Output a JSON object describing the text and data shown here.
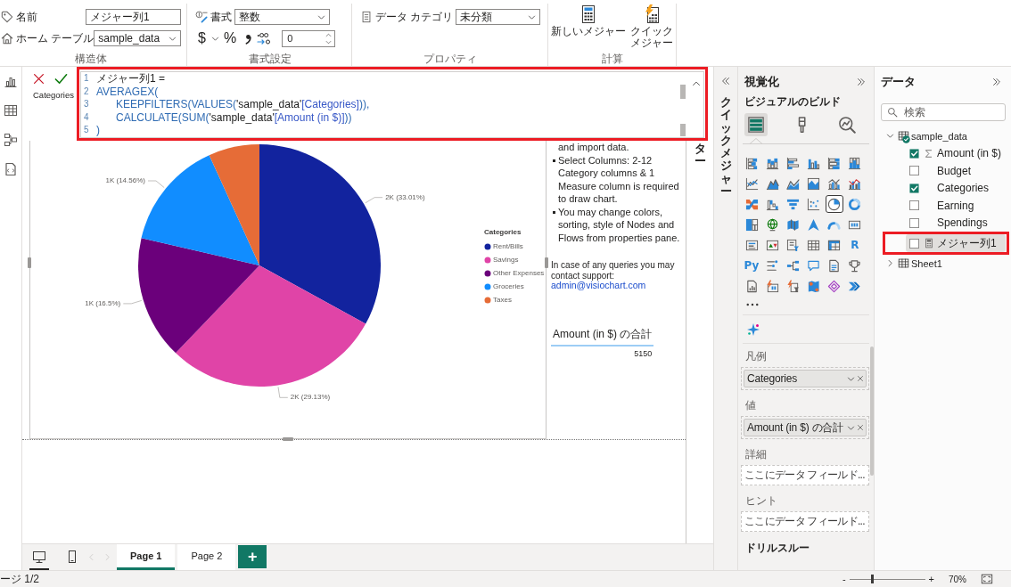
{
  "ribbon": {
    "structure": {
      "name_label": "名前",
      "name_value": "メジャー列1",
      "table_label": "ホーム テーブル",
      "table_value": "sample_data",
      "group_label": "構造体"
    },
    "formatting": {
      "format_label": "書式",
      "format_value": "整数",
      "currency_symbol": "$",
      "percent_symbol": "%",
      "decimal_places": "0",
      "group_label": "書式設定"
    },
    "properties": {
      "category_label": "データ カテゴリ",
      "category_value": "未分類",
      "group_label": "プロパティ"
    },
    "calculations": {
      "buttons": [
        {
          "kind": "new",
          "label": "新しいメジャー"
        },
        {
          "kind": "quick",
          "label": "クイックメジャー"
        }
      ],
      "group_label": "計算"
    }
  },
  "view_rail": {
    "views": [
      {
        "kind": "report"
      },
      {
        "kind": "table"
      },
      {
        "kind": "model"
      },
      {
        "kind": "query"
      }
    ]
  },
  "formula_bar": {
    "highlighted": true,
    "lines": [
      {
        "number": "1",
        "indent": false,
        "tokens": [
          {
            "kind": "plain",
            "text": "メジャー列1 ="
          }
        ]
      },
      {
        "number": "2",
        "indent": false,
        "tokens": [
          {
            "kind": "function",
            "text": "AVERAGEX("
          }
        ]
      },
      {
        "number": "3",
        "indent": true,
        "tokens": [
          {
            "kind": "function",
            "text": "KEEPFILTERS(VALUES("
          },
          {
            "kind": "table",
            "text": "'sample_data'"
          },
          {
            "kind": "column",
            "text": "[Categories]"
          },
          {
            "kind": "function",
            "text": ")),"
          }
        ]
      },
      {
        "number": "4",
        "indent": true,
        "tokens": [
          {
            "kind": "function",
            "text": "CALCULATE(SUM("
          },
          {
            "kind": "table",
            "text": "'sample_data'"
          },
          {
            "kind": "column",
            "text": "[Amount (in $)]"
          },
          {
            "kind": "function",
            "text": "))"
          }
        ]
      },
      {
        "number": "5",
        "indent": false,
        "tokens": [
          {
            "kind": "function",
            "text": ")"
          }
        ]
      }
    ]
  },
  "canvas": {
    "pie_visual": {
      "chart_data": {
        "type": "pie",
        "title": "Categories",
        "categories": [
          "Rent/Bills",
          "Savings",
          "Other Expenses",
          "Groceries",
          "Taxes"
        ],
        "values": [
          1700,
          1500,
          850,
          750,
          350
        ],
        "colors": [
          "#12239e",
          "#e044a7",
          "#6b007b",
          "#118dff",
          "#e66c37"
        ],
        "value_labels": [
          "2K (33.01%)",
          "2K (29.13%)",
          "1K (16.5%)",
          "1K (14.56%)",
          null
        ],
        "legend": {
          "title": "Categories"
        }
      }
    },
    "text_visual": {
      "paragraphs": [
        {
          "bullet": false,
          "text": "and import data."
        },
        {
          "bullet": true,
          "text": "Select Columns: 2-12 Category columns & 1 Measure column is required to draw chart."
        },
        {
          "bullet": true,
          "text": "You may change colors, sorting, style of Nodes and Flows from properties pane."
        }
      ],
      "contact": "In case of any queries you may contact support:",
      "email": "admin@visiochart.com"
    },
    "table_visual": {
      "column": "Amount (in $) の合計",
      "value": "5150"
    }
  },
  "filters_pane": {
    "label": "ター"
  },
  "quick_measure_pane": {
    "label": "クイックメジャー"
  },
  "visualizations_pane": {
    "title": "視覚化",
    "subtitle": "ビジュアルのビルド",
    "build_tabs": [
      {
        "kind": "build",
        "selected": true
      },
      {
        "kind": "format",
        "selected": false
      },
      {
        "kind": "analytics",
        "selected": false
      }
    ],
    "visual_types": [
      {
        "kind": "stacked-bar",
        "selected": false
      },
      {
        "kind": "stacked-column",
        "selected": false
      },
      {
        "kind": "clustered-bar",
        "selected": false
      },
      {
        "kind": "clustered-column",
        "selected": false
      },
      {
        "kind": "full-bar",
        "selected": false
      },
      {
        "kind": "full-column",
        "selected": false
      },
      {
        "kind": "line",
        "selected": false
      },
      {
        "kind": "area",
        "selected": false
      },
      {
        "kind": "stacked-area",
        "selected": false
      },
      {
        "kind": "full-area",
        "selected": false
      },
      {
        "kind": "line-stacked-column",
        "selected": false
      },
      {
        "kind": "line-clustered-column",
        "selected": false
      },
      {
        "kind": "ribbon",
        "selected": false
      },
      {
        "kind": "waterfall",
        "selected": false
      },
      {
        "kind": "funnel",
        "selected": false
      },
      {
        "kind": "scatter",
        "selected": false
      },
      {
        "kind": "pie",
        "selected": true
      },
      {
        "kind": "donut",
        "selected": false
      },
      {
        "kind": "treemap",
        "selected": false
      },
      {
        "kind": "globe",
        "selected": false
      },
      {
        "kind": "filled-map",
        "selected": false
      },
      {
        "kind": "arrow-map",
        "selected": false
      },
      {
        "kind": "gauge",
        "selected": false
      },
      {
        "kind": "card",
        "selected": false
      },
      {
        "kind": "multi-card",
        "selected": false
      },
      {
        "kind": "kpi",
        "selected": false
      },
      {
        "kind": "slicer",
        "selected": false
      },
      {
        "kind": "table",
        "selected": false
      },
      {
        "kind": "matrix",
        "selected": false
      },
      {
        "kind": "r-script",
        "text": "R",
        "selected": false
      },
      {
        "kind": "python-script",
        "text": "Py",
        "selected": false
      },
      {
        "kind": "influencers",
        "selected": false
      },
      {
        "kind": "decomposition",
        "selected": false
      },
      {
        "kind": "qa",
        "selected": false
      },
      {
        "kind": "narrative",
        "selected": false
      },
      {
        "kind": "trophy",
        "selected": false
      },
      {
        "kind": "paginated",
        "selected": false
      },
      {
        "kind": "card-bolt",
        "selected": false
      },
      {
        "kind": "slicer-bolt",
        "selected": false
      },
      {
        "kind": "azure-map",
        "selected": false
      },
      {
        "kind": "diamond",
        "selected": false
      },
      {
        "kind": "chevrons",
        "selected": false
      }
    ],
    "wells": [
      {
        "label": "凡例",
        "fields": [
          "Categories"
        ]
      },
      {
        "label": "値",
        "fields": [
          "Amount (in $) の合計"
        ]
      },
      {
        "label": "詳細",
        "placeholder": "ここにデータ フィールド..."
      },
      {
        "label": "ヒント",
        "placeholder": "ここにデータ フィールド..."
      }
    ],
    "drillthrough": "ドリルスルー"
  },
  "data_pane": {
    "title": "データ",
    "search": {
      "placeholder": "検索"
    },
    "tables": [
      {
        "name": "sample_data",
        "expanded": true,
        "in_use": true,
        "children": [
          {
            "name": "Amount (in $)",
            "kind": "sum",
            "checked": true,
            "selected": false,
            "highlighted": false
          },
          {
            "name": "Budget",
            "kind": "column",
            "checked": false,
            "selected": false,
            "highlighted": false
          },
          {
            "name": "Categories",
            "kind": "column",
            "checked": true,
            "selected": false,
            "highlighted": false
          },
          {
            "name": "Earning",
            "kind": "column",
            "checked": false,
            "selected": false,
            "highlighted": false
          },
          {
            "name": "Spendings",
            "kind": "column",
            "checked": false,
            "selected": false,
            "highlighted": false
          },
          {
            "name": "メジャー列1",
            "kind": "measure",
            "checked": false,
            "selected": true,
            "highlighted": true
          }
        ]
      },
      {
        "name": "Sheet1",
        "expanded": false,
        "in_use": false
      }
    ]
  },
  "page_bar": {
    "views": [
      {
        "kind": "desktop",
        "selected": true
      },
      {
        "kind": "mobile",
        "selected": false
      }
    ],
    "pages": [
      {
        "label": "Page 1",
        "selected": true
      },
      {
        "label": "Page 2",
        "selected": false
      }
    ],
    "add_label": "+"
  },
  "status_bar": {
    "page_info": "ージ 1/2",
    "zoom": {
      "minus": "-",
      "level": 0.3,
      "plus": "+",
      "reading": "70%"
    }
  }
}
